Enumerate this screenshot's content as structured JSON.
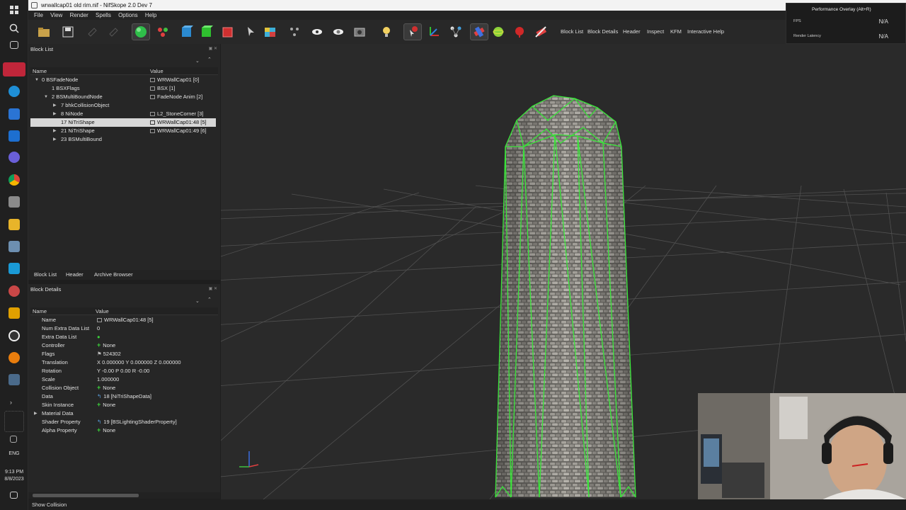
{
  "window": {
    "title": "wrwallcap01 old rim.nif - NifSkope 2.0 Dev 7"
  },
  "menu": [
    "File",
    "View",
    "Render",
    "Spells",
    "Options",
    "Help"
  ],
  "toolbar": {
    "text_buttons": [
      "Block List",
      "Block Details",
      "Header",
      "Inspect",
      "KFM",
      "Interactive Help"
    ],
    "icons": [
      "open-folder-icon",
      "save-icon",
      "undo-icon",
      "redo-icon",
      "globe-icon",
      "molecule-icon",
      "cube-blue-icon",
      "cube-green-icon",
      "cube-red-icon",
      "cursor-icon",
      "texture-cube-icon",
      "vertices-icon",
      "eye-icon",
      "eye-alt-icon",
      "snapshot-icon",
      "light-bulb-icon",
      "pick-icon",
      "axes-icon",
      "nodes-icon",
      "constraint-icon",
      "sphere-icon",
      "marker-icon",
      "hide-icon"
    ]
  },
  "overlay": {
    "header": "Performance Overlay (Alt+R)",
    "fps_label": "FPS",
    "fps_value": "N/A",
    "latency_label": "Render Latency",
    "latency_value": "N/A"
  },
  "block_list": {
    "title": "Block List",
    "col_name": "Name",
    "col_value": "Value",
    "rows": [
      {
        "name": "0 BSFadeNode",
        "value": "WRWallCap01 [0]"
      },
      {
        "name": "1 BSXFlags",
        "value": "BSX [1]"
      },
      {
        "name": "2 BSMultiBoundNode",
        "value": "FadeNode Anim [2]"
      },
      {
        "name": "7 bhkCollisionObject",
        "value": ""
      },
      {
        "name": "8 NiNode",
        "value": "L2_StoneCorner [3]"
      },
      {
        "name": "17 NiTriShape",
        "value": "WRWallCap01:48 [5]"
      },
      {
        "name": "21 NiTriShape",
        "value": "WRWallCap01:49 [6]"
      },
      {
        "name": "23 BSMultiBound",
        "value": ""
      }
    ]
  },
  "tabs": [
    "Block List",
    "Header",
    "Archive Browser"
  ],
  "block_details": {
    "title": "Block Details",
    "col_name": "Name",
    "col_value": "Value",
    "rows": [
      {
        "name": "Name",
        "value": "WRWallCap01:48 [5]"
      },
      {
        "name": "Num Extra Data List",
        "value": "0"
      },
      {
        "name": "Extra Data List",
        "value": ""
      },
      {
        "name": "Controller",
        "value": "None"
      },
      {
        "name": "Flags",
        "value": "524302"
      },
      {
        "name": "Translation",
        "value": "X 0.000000 Y 0.000000 Z 0.000000"
      },
      {
        "name": "Rotation",
        "value": "Y -0.00 P 0.00 R -0.00"
      },
      {
        "name": "Scale",
        "value": "1.000000"
      },
      {
        "name": "Collision Object",
        "value": "None"
      },
      {
        "name": "Data",
        "value": "18 [NiTriShapeData]"
      },
      {
        "name": "Skin Instance",
        "value": "None"
      },
      {
        "name": "Material Data",
        "value": ""
      },
      {
        "name": "Shader Property",
        "value": "19 [BSLightingShaderProperty]"
      },
      {
        "name": "Alpha Property",
        "value": "None"
      }
    ]
  },
  "status": {
    "text": "Show Collision"
  },
  "taskbar": {
    "lang": "ENG",
    "time": "9:13 PM",
    "date": "8/8/2023"
  },
  "colors": {
    "wireframe": "#39e639",
    "selection": "#d7d7d7",
    "grid": "#5a5a5a"
  }
}
